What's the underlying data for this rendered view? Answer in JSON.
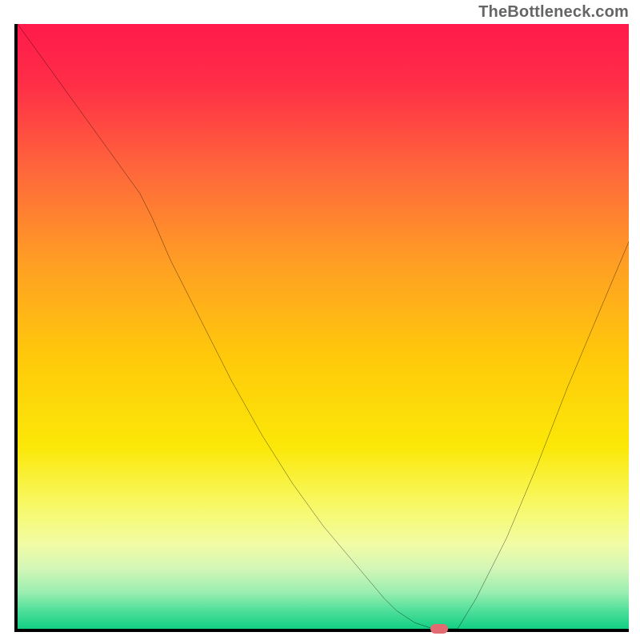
{
  "watermark": "TheBottleneck.com",
  "chart_data": {
    "type": "line",
    "title": "",
    "xlabel": "",
    "ylabel": "",
    "xlim": [
      0,
      100
    ],
    "ylim": [
      0,
      100
    ],
    "x": [
      0,
      5,
      10,
      15,
      20,
      22,
      25,
      30,
      35,
      40,
      45,
      50,
      55,
      60,
      62,
      65,
      68,
      70,
      72,
      75,
      80,
      85,
      90,
      95,
      100
    ],
    "y": [
      100,
      93,
      86,
      79,
      72,
      68,
      61,
      51,
      41,
      32,
      24,
      17,
      11,
      5,
      3,
      1,
      0,
      0,
      0,
      5,
      15,
      27,
      40,
      52,
      64
    ],
    "marker": {
      "x": 69,
      "y": 0
    },
    "background_gradient": {
      "stops": [
        {
          "offset": 0.0,
          "color": "#ff1a4b"
        },
        {
          "offset": 0.1,
          "color": "#ff2e47"
        },
        {
          "offset": 0.25,
          "color": "#ff6a3a"
        },
        {
          "offset": 0.4,
          "color": "#ffa023"
        },
        {
          "offset": 0.55,
          "color": "#ffc90a"
        },
        {
          "offset": 0.7,
          "color": "#fbe808"
        },
        {
          "offset": 0.8,
          "color": "#f7f96a"
        },
        {
          "offset": 0.86,
          "color": "#f2fca5"
        },
        {
          "offset": 0.9,
          "color": "#d3f6b6"
        },
        {
          "offset": 0.94,
          "color": "#99eeb0"
        },
        {
          "offset": 0.97,
          "color": "#4fdf9a"
        },
        {
          "offset": 1.0,
          "color": "#12cf84"
        }
      ]
    }
  }
}
